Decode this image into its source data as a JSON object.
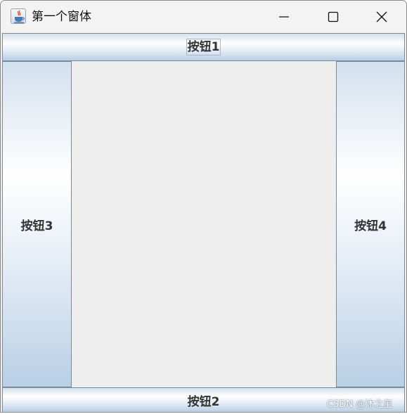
{
  "window": {
    "title": "第一个窗体",
    "icon": "java-coffee-icon",
    "controls": {
      "minimize": "minimize-icon",
      "maximize": "maximize-icon",
      "close": "close-icon"
    }
  },
  "buttons": {
    "north": "按钮1",
    "south": "按钮2",
    "west": "按钮3",
    "east": "按钮4"
  },
  "watermark": "CSDN @沐之玺",
  "colors": {
    "button_gradient_top": "#d3e0ee",
    "button_gradient_mid": "#ffffff",
    "button_gradient_bottom": "#b8cfe5",
    "content_background": "#eeeeee"
  }
}
